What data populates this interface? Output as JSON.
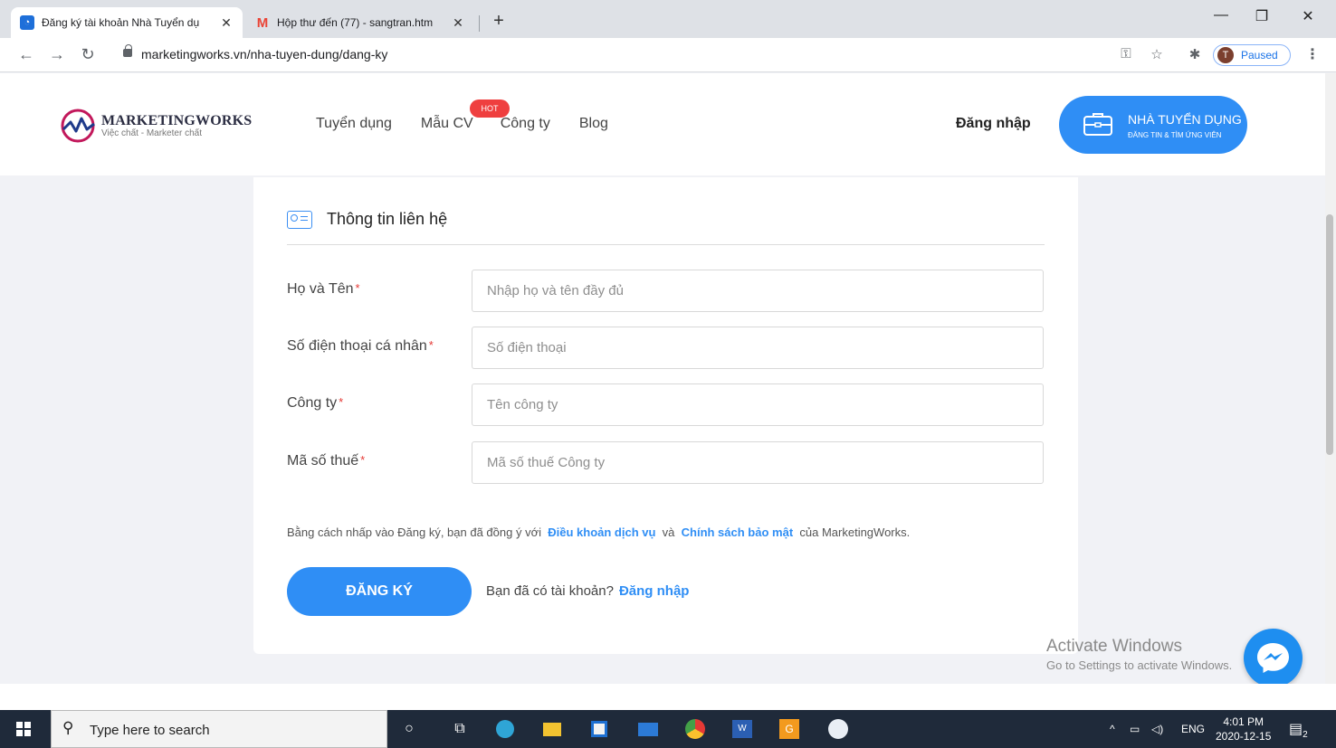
{
  "browser": {
    "tabs": [
      {
        "title": "Đăng ký tài khoản Nhà Tuyển dụ",
        "close": "✕"
      },
      {
        "title": "Hộp thư đến (77) - sangtran.htm",
        "close": "✕"
      }
    ],
    "new_tab": "+",
    "url": "marketingworks.vn/nha-tuyen-dung/dang-ky",
    "profile_initial": "T",
    "profile_status": "Paused",
    "window_controls": {
      "minimize": "—",
      "restore": "❐",
      "close": "✕"
    }
  },
  "site": {
    "logo_name": "MARKETINGWORKS",
    "logo_tagline": "Việc chất - Marketer chất",
    "nav": [
      "Tuyển dụng",
      "Mẫu CV",
      "Công ty",
      "Blog"
    ],
    "hot_badge": "HOT",
    "login_label": "Đăng nhập",
    "employer_button": {
      "title": "NHÀ TUYỂN DỤNG",
      "subtitle": "ĐĂNG TIN & TÌM ỨNG VIÊN"
    }
  },
  "form": {
    "section_title": "Thông tin liên hệ",
    "required_mark": "*",
    "fields": [
      {
        "label": "Họ và Tên",
        "placeholder": "Nhập họ và tên đầy đủ",
        "value": ""
      },
      {
        "label": "Số điện thoại cá nhân",
        "placeholder": "Số điện thoại",
        "value": ""
      },
      {
        "label": "Công ty",
        "placeholder": "Tên công ty",
        "value": ""
      },
      {
        "label": "Mã số thuế",
        "placeholder": "Mã số thuế Công ty",
        "value": ""
      }
    ],
    "terms": {
      "prefix": "Bằng cách nhấp vào Đăng ký, bạn đã đồng ý với",
      "terms_link": "Điều khoản dịch vụ",
      "and": "và",
      "privacy_link": "Chính sách bảo mật",
      "suffix": "của MarketingWorks."
    },
    "register_button": "ĐĂNG KÝ",
    "has_account_text": "Bạn đã có tài khoản?",
    "login_link": "Đăng nhập"
  },
  "watermark": {
    "line1": "Activate Windows",
    "line2": "Go to Settings to activate Windows."
  },
  "taskbar": {
    "search_placeholder": "Type here to search",
    "apps": [
      "cortana-icon",
      "task-view-icon",
      "edge-icon",
      "file-explorer-icon",
      "store-icon",
      "mail-icon",
      "chrome-icon",
      "word-icon",
      "app-g-icon",
      "zalo-icon"
    ],
    "tray_language": "ENG",
    "time": "4:01 PM",
    "date": "2020-12-15",
    "notification_count": "2"
  },
  "colors": {
    "accent": "#2f8ef5",
    "required": "#e53935",
    "hot": "#ef3f3f",
    "taskbar": "#1f2a3a"
  }
}
